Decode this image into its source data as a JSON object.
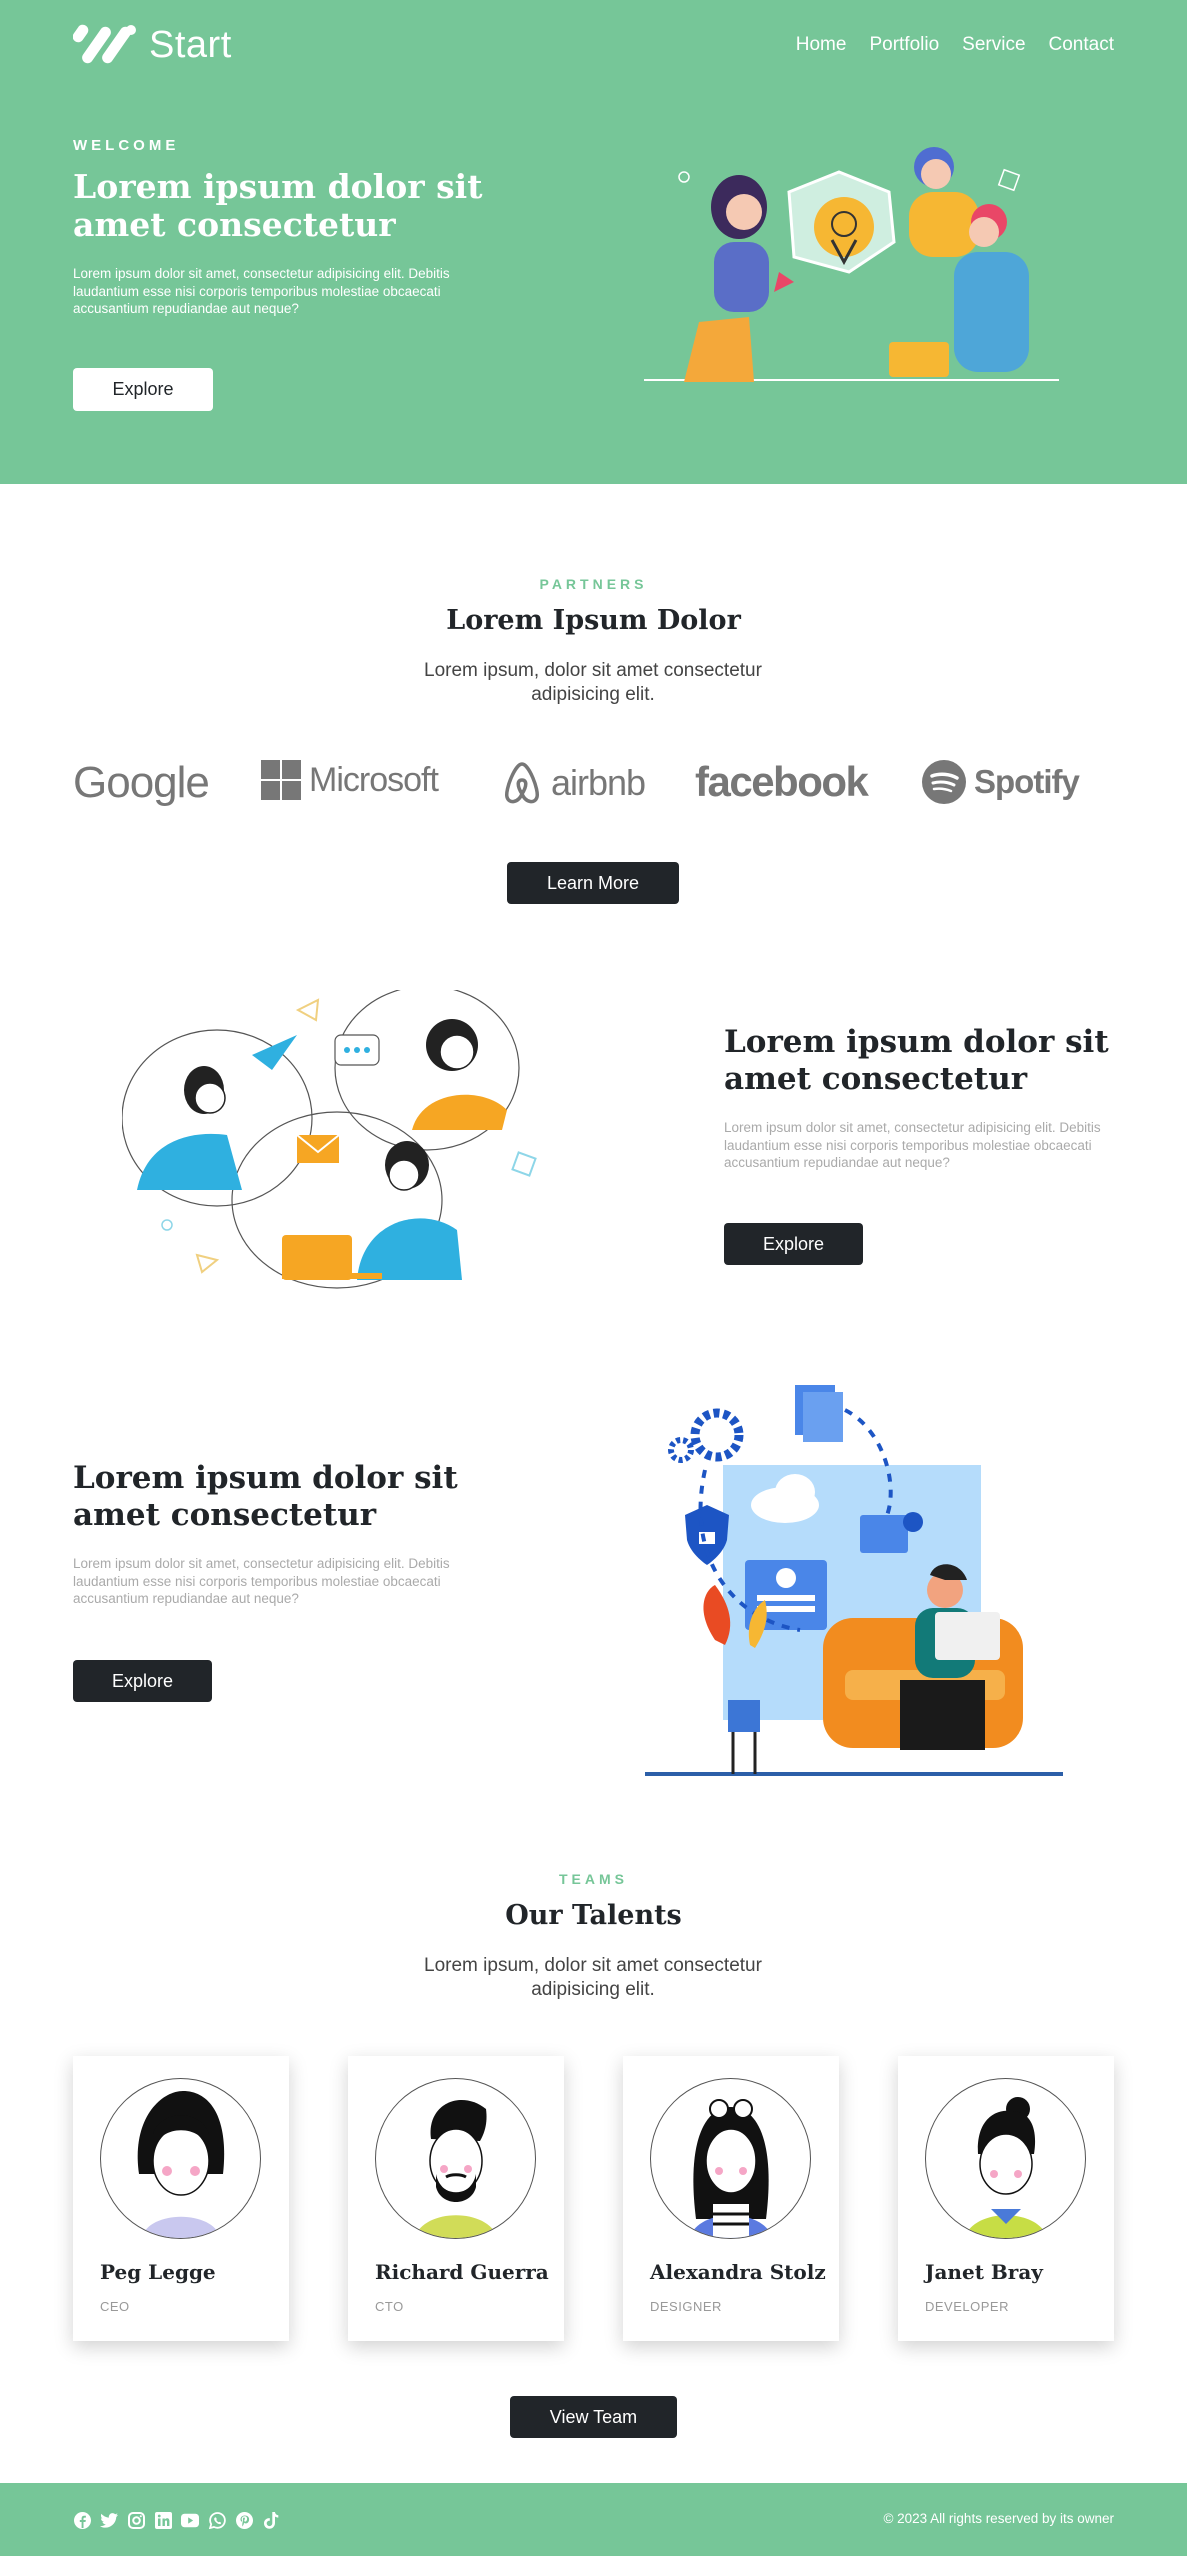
{
  "nav": {
    "brand": "Start",
    "links": [
      "Home",
      "Portfolio",
      "Service",
      "Contact"
    ]
  },
  "hero": {
    "eyebrow": "WELCOME",
    "title": "Lorem ipsum dolor sit amet consectetur",
    "text": "Lorem ipsum dolor sit amet, consectetur adipisicing elit. Debitis laudantium esse nisi corporis temporibus molestiae obcaecati accusantium repudiandae aut neque?",
    "button": "Explore"
  },
  "partners": {
    "eyebrow": "PARTNERS",
    "title": "Lorem Ipsum Dolor",
    "subtitle": "Lorem ipsum, dolor sit amet consectetur adipisicing elit.",
    "logos": [
      "Google",
      "Microsoft",
      "airbnb",
      "facebook",
      "Spotify"
    ],
    "button": "Learn More"
  },
  "feature1": {
    "title": "Lorem ipsum dolor sit amet consectetur",
    "text": "Lorem ipsum dolor sit amet, consectetur adipisicing elit. Debitis laudantium esse nisi corporis temporibus molestiae obcaecati accusantium repudiandae aut neque?",
    "button": "Explore"
  },
  "feature2": {
    "title": "Lorem ipsum dolor sit amet consectetur",
    "text": "Lorem ipsum dolor sit amet, consectetur adipisicing elit. Debitis laudantium esse nisi corporis temporibus molestiae obcaecati accusantium repudiandae aut neque?",
    "button": "Explore"
  },
  "team": {
    "eyebrow": "TEAMS",
    "title": "Our Talents",
    "subtitle": "Lorem ipsum, dolor sit amet consectetur adipisicing elit.",
    "members": [
      {
        "name": "Peg Legge",
        "role": "CEO"
      },
      {
        "name": "Richard Guerra",
        "role": "CTO"
      },
      {
        "name": "Alexandra Stolz",
        "role": "DESIGNER"
      },
      {
        "name": "Janet Bray",
        "role": "DEVELOPER"
      }
    ],
    "button": "View Team"
  },
  "footer": {
    "social_icons": [
      "facebook-icon",
      "twitter-icon",
      "instagram-icon",
      "linkedin-icon",
      "youtube-icon",
      "whatsapp-icon",
      "pinterest-icon",
      "tiktok-icon"
    ],
    "copyright": "© 2023 All rights reserved by its owner"
  },
  "colors": {
    "brand_green": "#76c698",
    "dark_button": "#212529",
    "white": "#ffffff"
  }
}
